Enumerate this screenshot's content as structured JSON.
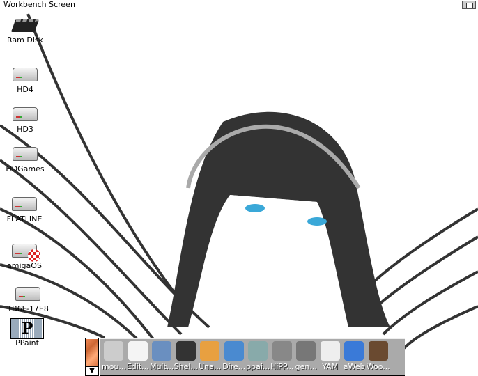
{
  "screen": {
    "title": "Workbench Screen"
  },
  "desktop_icons": [
    {
      "label": "Ram Disk",
      "icon": "ram-chip-icon"
    },
    {
      "label": "HD4",
      "icon": "hard-drive-icon"
    },
    {
      "label": "HD3",
      "icon": "hard-drive-icon"
    },
    {
      "label": "HDGames",
      "icon": "hard-drive-icon"
    },
    {
      "label": "FLATLINE",
      "icon": "hard-drive-icon"
    },
    {
      "label": "amigaOS",
      "icon": "boing-ball-drive-icon"
    },
    {
      "label": "1B6F-17E8",
      "icon": "hard-drive-icon"
    },
    {
      "label": "PPaint",
      "icon": "ppaint-icon"
    }
  ],
  "dock": {
    "items": [
      {
        "label": "mou...",
        "icon": "cfg-disc-icon",
        "color": "#ccc"
      },
      {
        "label": "Edit...",
        "icon": "document-icon",
        "color": "#f4f4f4"
      },
      {
        "label": "Mult...",
        "icon": "magnifier-icon",
        "color": "#6a8fc0"
      },
      {
        "label": "Shel...",
        "icon": "terminal-icon",
        "color": "#333"
      },
      {
        "label": "Una...",
        "icon": "box-icon",
        "color": "#e8a040"
      },
      {
        "label": "Dire...",
        "icon": "download-drive-icon",
        "color": "#4a8ad0"
      },
      {
        "label": "ppai...",
        "icon": "paint-brush-icon",
        "color": "#8aa"
      },
      {
        "label": "HiPP...",
        "icon": "speaker-icon",
        "color": "#888"
      },
      {
        "label": "gen...",
        "icon": "network-globe-icon",
        "color": "#777"
      },
      {
        "label": "YAM",
        "icon": "mail-icon",
        "color": "#eee"
      },
      {
        "label": "aWeb",
        "icon": "globe-icon",
        "color": "#3a7ad8"
      },
      {
        "label": "Woo...",
        "icon": "wookiee-icon",
        "color": "#6a4a30"
      }
    ]
  }
}
